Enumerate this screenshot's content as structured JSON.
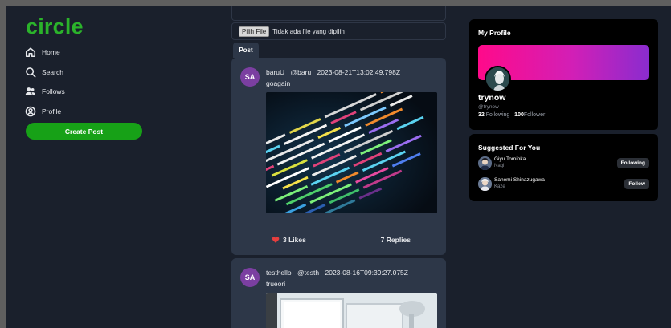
{
  "sidebar": {
    "brand": "circle",
    "items": [
      {
        "label": "Home",
        "icon": "home-icon"
      },
      {
        "label": "Search",
        "icon": "search-icon"
      },
      {
        "label": "Follows",
        "icon": "users-icon"
      },
      {
        "label": "Profile",
        "icon": "profile-icon"
      }
    ],
    "create_post": "Create Post"
  },
  "compose": {
    "file_button": "Pilih File",
    "file_status": "Tidak ada file yang dipilih"
  },
  "tabs": {
    "post": "Post"
  },
  "posts": [
    {
      "avatar": "SA",
      "name": "baruU",
      "handle": "@baru",
      "timestamp": "2023-08-21T13:02:49.798Z",
      "content": "goagain",
      "likes": "3 Likes",
      "replies": "7 Replies"
    },
    {
      "avatar": "SA",
      "name": "testhello",
      "handle": "@testh",
      "timestamp": "2023-08-16T09:39:27.075Z",
      "content": "trueori"
    }
  ],
  "profile": {
    "title": "My Profile",
    "name": "trynow",
    "handle": "@trynow",
    "following_count": "32",
    "following_label": "Following",
    "follower_count": "100",
    "follower_label": "Follower"
  },
  "suggested": {
    "title": "Suggested For You",
    "users": [
      {
        "name": "Giyu Tomioka",
        "handle": "Nagi",
        "button": "Following"
      },
      {
        "name": "Sanemi Shinazugawa",
        "handle": "Kaze",
        "button": "Follow"
      }
    ]
  },
  "colors": {
    "accent_green": "#17a117",
    "brand_green": "#2bb32b",
    "like_red": "#e53e3e",
    "avatar_purple": "#7b3fa1"
  }
}
